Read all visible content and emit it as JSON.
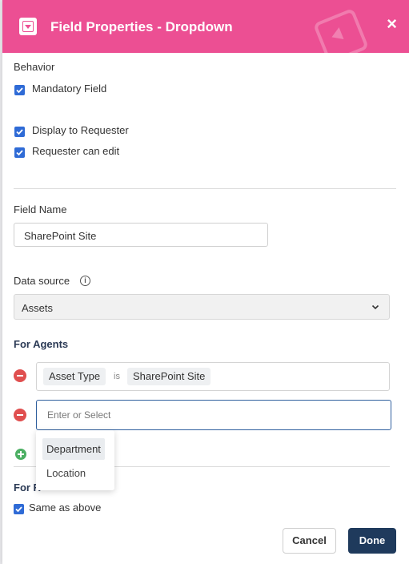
{
  "dialog": {
    "title": "Field Properties - Dropdown",
    "close_label": "×",
    "colors": {
      "header": "#ec4f93",
      "primary": "#1f3a5c",
      "checkbox": "#2f6bd6"
    }
  },
  "behavior": {
    "title": "Behavior",
    "mandatory": {
      "label": "Mandatory Field",
      "checked": true
    },
    "display_to_requester": {
      "label": "Display to Requester",
      "checked": true
    },
    "requester_can_edit": {
      "label": "Requester can edit",
      "checked": true
    }
  },
  "field_name": {
    "label": "Field Name",
    "value": "SharePoint Site"
  },
  "data_source": {
    "label": "Data source",
    "value": "Assets"
  },
  "for_agents": {
    "title": "For Agents",
    "condition": {
      "attribute": "Asset Type",
      "operator": "is",
      "value": "SharePoint Site"
    },
    "new_condition_placeholder": "Enter or Select",
    "dropdown_options": [
      "Department",
      "Location"
    ]
  },
  "for_requesters": {
    "title_partial": "For R",
    "same_as_above": {
      "label": "Same as above",
      "checked": true
    }
  },
  "footer": {
    "cancel": "Cancel",
    "done": "Done"
  }
}
